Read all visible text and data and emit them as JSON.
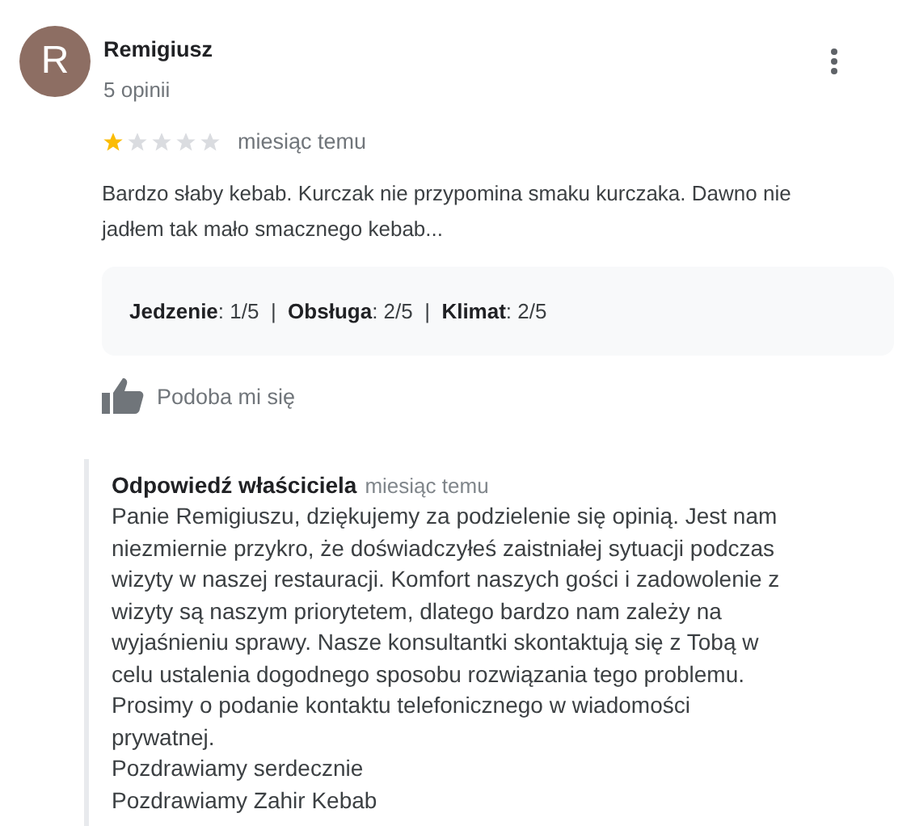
{
  "review": {
    "author": {
      "initial": "R",
      "name": "Remigiusz",
      "count": "5 opinii"
    },
    "stars": 1,
    "time": "miesiąc temu",
    "text": "Bardzo słaby kebab. Kurczak nie przypomina smaku kurczaka. Dawno nie jadłem tak mało smacznego kebab...",
    "ratings": "**Jedzenie**: 1/5  |  **Obsługa**: 2/5  |  **Klimat**: 2/5",
    "like": {
      "label": "Podoba mi się"
    }
  },
  "owner_reply": {
    "title": "Odpowiedź właściciela",
    "time": "miesiąc temu",
    "paragraphs": [
      "Panie Remigiuszu, dziękujemy za podzielenie się opinią. Jest nam niezmiernie przykro, że doświadczyłeś zaistniałej sytuacji podczas wizyty w naszej restauracji. Komfort naszych gości i zadowolenie z wizyty są naszym priorytetem, dlatego bardzo nam zależy na wyjaśnieniu sprawy. Nasze konsultantki skontaktują się z Tobą w celu ustalenia dogodnego sposobu rozwiązania tego problemu. Prosimy o podanie kontaktu telefonicznego w wiadomości prywatnej.",
      "Pozdrawiamy serdecznie",
      "Pozdrawiamy Zahir Kebab"
    ]
  }
}
